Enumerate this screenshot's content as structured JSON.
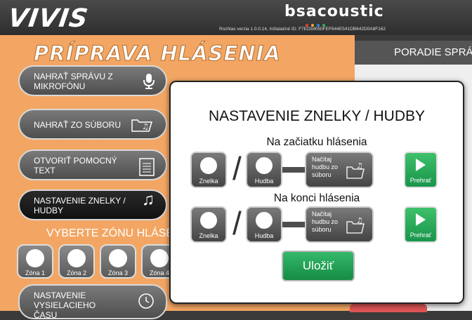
{
  "header": {
    "logo": "VIVIS",
    "brand": "bsacoustic",
    "version_info": "Rozhlas verzia 1.0.0.14, Inštalačné ID: F7ED59050FEF644E541DB642D0A8F162",
    "accent_colors": [
      "#e23b3b",
      "#f6a623",
      "#2c88d9",
      "#30b050"
    ]
  },
  "left": {
    "title": "PRÍPRAVA HLÁSENIA",
    "buttons": [
      {
        "label": "NAHRAŤ SPRÁVU Z MIKROFÓNU",
        "icon": "microphone-icon"
      },
      {
        "label": "NAHRAŤ ZO SÚBORU",
        "icon": "folder-music-icon"
      },
      {
        "label": "OTVORIŤ POMOCNÝ TEXT",
        "icon": "document-icon"
      },
      {
        "label": "NASTAVENIE ZNELKY / HUDBY",
        "icon": "music-note-icon"
      },
      {
        "label": "NASTAVENIE VYSIELACIEHO ČASU",
        "icon": "clock-icon"
      }
    ],
    "zone_title": "VYBERTE ZÓNU HLÁSE",
    "zones": [
      "Zóna 1",
      "Zóna 2",
      "Zóna 3",
      "Zóna 4"
    ]
  },
  "right": {
    "title": "PORADIE SPRÁ"
  },
  "modal": {
    "title": "NASTAVENIE ZNELKY / HUDBY",
    "start_label": "Na začiatku hlásenia",
    "end_label": "Na konci hlásenia",
    "jingle_label": "Znelka",
    "music_label": "Hudba",
    "load_music_label": "Načítaj hudbu zo súboru",
    "play_label": "Prehrať",
    "save_label": "Uložiť"
  }
}
